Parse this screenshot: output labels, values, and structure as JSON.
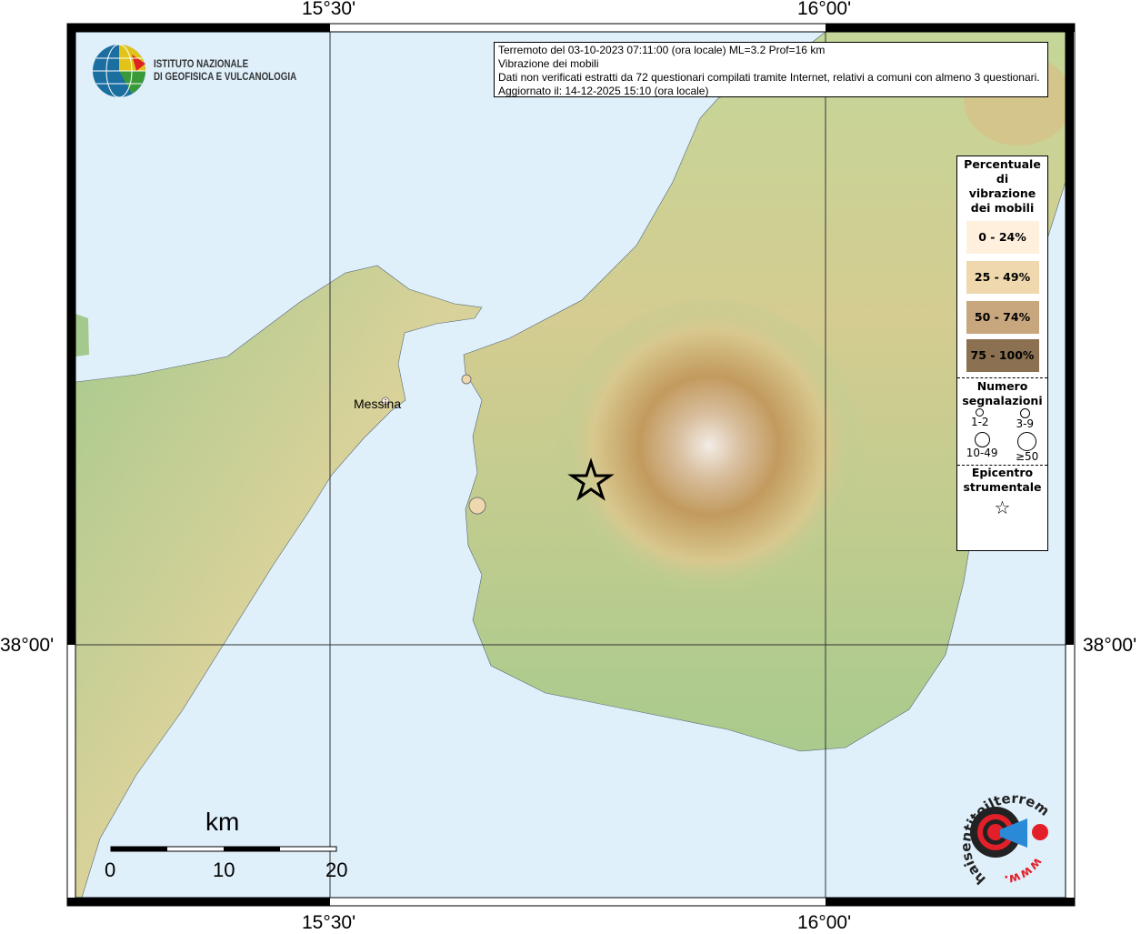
{
  "axes": {
    "lon_ticks": [
      "15°30'",
      "16°00'"
    ],
    "lat_ticks": [
      "38°00'"
    ]
  },
  "logo_ingv": {
    "line1": "ISTITUTO NAZIONALE",
    "line2": "DI GEOFISICA E VULCANOLOGIA"
  },
  "info": {
    "line1": "Terremoto del 03-10-2023 07:11:00 (ora locale) ML=3.2 Prof=16 km",
    "line2": "Vibrazione dei mobili",
    "line3": "Dati non verificati estratti da 72 questionari compilati tramite Internet, relativi a comuni con almeno 3 questionari.",
    "line4": "Aggiornato il: 14-12-2025 15:10 (ora locale)"
  },
  "legend": {
    "title": "Percentuale di vibrazione dei mobili",
    "classes": [
      {
        "label": "0 - 24%",
        "color": "#fef0dc"
      },
      {
        "label": "25 - 49%",
        "color": "#efd8ad"
      },
      {
        "label": "50 - 74%",
        "color": "#c8a77e"
      },
      {
        "label": "75 - 100%",
        "color": "#8b7151"
      }
    ],
    "count_title": "Numero segnalazioni",
    "counts": [
      "1-2",
      "3-9",
      "10-49",
      "≥50"
    ],
    "epicenter_title": "Epicentro strumentale"
  },
  "places": {
    "messina": "Messina"
  },
  "scale": {
    "unit": "km",
    "labels": [
      "0",
      "10",
      "20"
    ]
  },
  "logo_hsit": {
    "text": "haisentitoilterremoto.it",
    "www": "www.",
    "accent": "#e3202a"
  },
  "colors": {
    "sea": "#dff0fb",
    "land": "#9fc48b",
    "relief": "#b88f55"
  }
}
